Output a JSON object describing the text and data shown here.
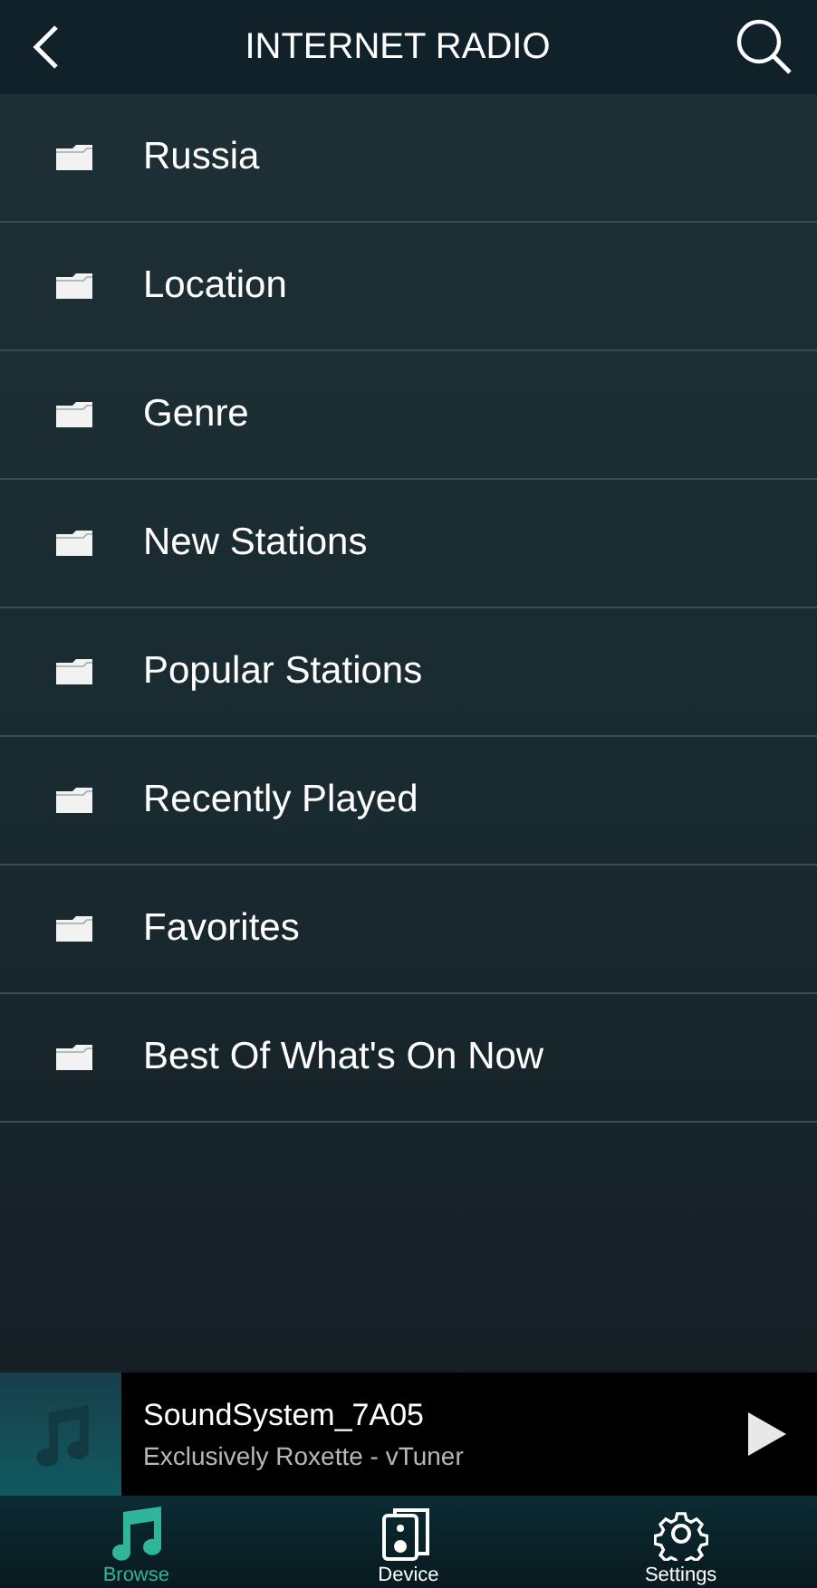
{
  "header": {
    "title": "INTERNET RADIO"
  },
  "items": [
    {
      "label": "Russia"
    },
    {
      "label": "Location"
    },
    {
      "label": "Genre"
    },
    {
      "label": "New Stations"
    },
    {
      "label": "Popular Stations"
    },
    {
      "label": "Recently Played"
    },
    {
      "label": "Favorites"
    },
    {
      "label": "Best Of What's On Now"
    }
  ],
  "now_playing": {
    "device": "SoundSystem_7A05",
    "track": "Exclusively Roxette - vTuner"
  },
  "tabs": [
    {
      "label": "Browse",
      "kind": "browse",
      "selected": true
    },
    {
      "label": "Device",
      "kind": "device",
      "selected": false
    },
    {
      "label": "Settings",
      "kind": "settings",
      "selected": false
    }
  ]
}
